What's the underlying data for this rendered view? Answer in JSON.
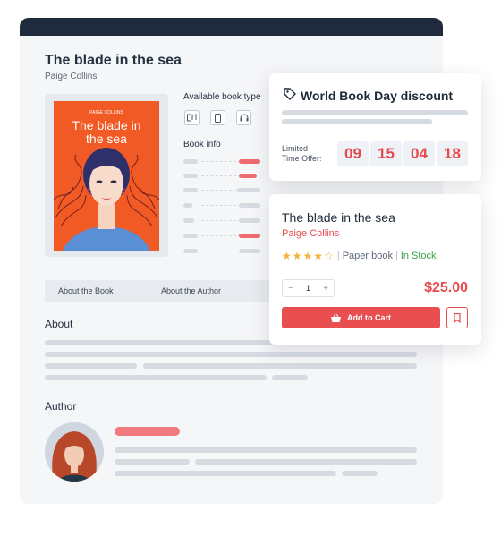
{
  "book": {
    "title": "The blade in the sea",
    "author": "Paige Collins",
    "cover_author": "PAIGE COLLINS",
    "cover_title_line1": "The blade in",
    "cover_title_line2": "the sea"
  },
  "labels": {
    "available_book_type": "Available book type",
    "book_info": "Book info",
    "about_heading": "About",
    "author_heading": "Author"
  },
  "book_types": [
    "audio-book-icon",
    "ebook-device-icon",
    "headphones-icon"
  ],
  "tabs": [
    {
      "label": "About the Book"
    },
    {
      "label": "About the Author"
    }
  ],
  "discount": {
    "title": "World Book Day discount",
    "limited_line1": "Limited",
    "limited_line2": "Time Offer:",
    "countdown": [
      "09",
      "15",
      "04",
      "18"
    ]
  },
  "product": {
    "title": "The blade in the sea",
    "author": "Paige Collins",
    "rating_out_of_5": 4,
    "format": "Paper book",
    "stock": "In Stock",
    "quantity": "1",
    "minus": "−",
    "plus": "+",
    "price": "$25.00",
    "add_to_cart": "Add to Cart"
  },
  "colors": {
    "accent": "#e94e51",
    "header": "#1f2a3c",
    "cover_bg": "#f15a24",
    "in_stock": "#3aa44a"
  }
}
